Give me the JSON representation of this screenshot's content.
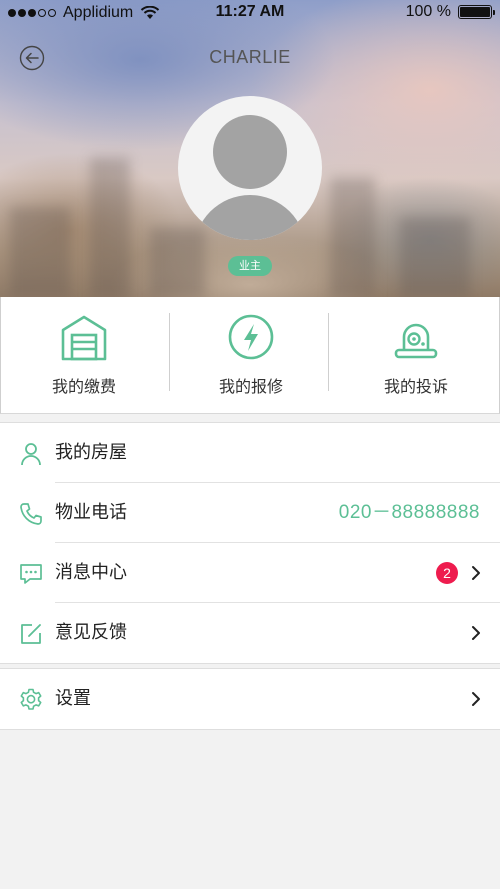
{
  "status_bar": {
    "carrier": "Applidium",
    "time": "11:27 AM",
    "battery": "100 %"
  },
  "nav": {
    "title": "CHARLIE",
    "back_icon": "back-arrow-circle-icon"
  },
  "profile": {
    "avatar_icon": "default-avatar-icon",
    "role": "业主"
  },
  "quick_actions": [
    {
      "label": "我的缴费",
      "icon": "garage-icon"
    },
    {
      "label": "我的报修",
      "icon": "lightning-icon"
    },
    {
      "label": "我的投诉",
      "icon": "camera-icon"
    }
  ],
  "menu": [
    {
      "label": "我的房屋",
      "icon": "person-icon"
    },
    {
      "label": "物业电话",
      "icon": "phone-icon",
      "value": "020－88888888"
    },
    {
      "label": "消息中心",
      "icon": "message-icon",
      "badge": "2"
    },
    {
      "label": "意见反馈",
      "icon": "edit-icon"
    }
  ],
  "settings": {
    "label": "设置",
    "icon": "gear-icon"
  },
  "colors": {
    "accent": "#5cbf95",
    "badge": "#ee1c4e",
    "background": "#f2f2f2"
  }
}
